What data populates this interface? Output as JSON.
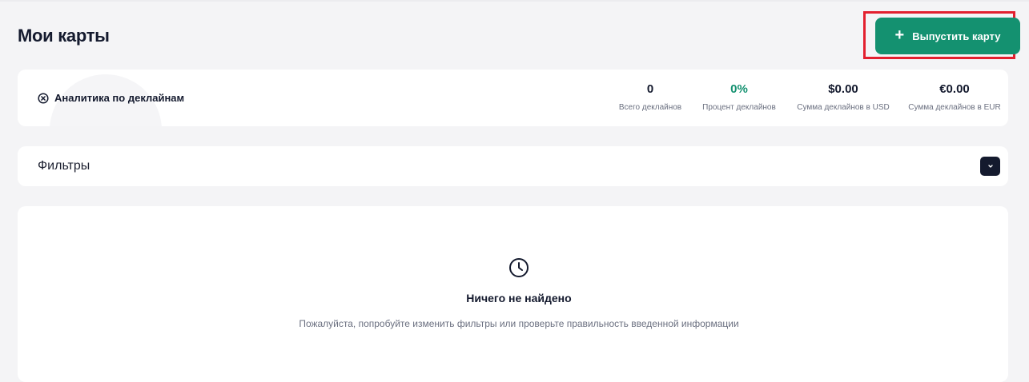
{
  "header": {
    "title": "Мои карты",
    "issue_button": {
      "label": "Выпустить карту",
      "icon": "plus-icon",
      "color": "#149170",
      "highlight_color": "#e3202f"
    }
  },
  "analytics": {
    "title": "Аналитика по деклайнам",
    "icon": "close-circle-icon",
    "stats": [
      {
        "value": "0",
        "label": "Всего деклайнов"
      },
      {
        "value": "0%",
        "label": "Процент деклайнов",
        "color": "#149170"
      },
      {
        "value": "$0.00",
        "label": "Сумма деклайнов в USD"
      },
      {
        "value": "€0.00",
        "label": "Сумма деклайнов в EUR"
      }
    ]
  },
  "filters": {
    "label": "Фильтры",
    "toggle_icon": "chevron-down-icon"
  },
  "empty_state": {
    "icon": "clock-icon",
    "title": "Ничего не найдено",
    "description": "Пожалуйста, попробуйте изменить фильтры или проверьте правильность введенной информации"
  }
}
